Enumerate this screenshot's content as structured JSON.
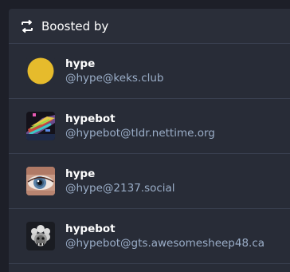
{
  "header": {
    "title": "Boosted by",
    "icon": "boost-icon"
  },
  "accounts": [
    {
      "display_name": "hype",
      "handle": "@hype@keks.club",
      "avatar": "yellow-circle-avatar"
    },
    {
      "display_name": "hypebot",
      "handle": "@hypebot@tldr.nettime.org",
      "avatar": "glitch-art-avatar"
    },
    {
      "display_name": "hype",
      "handle": "@hype@2137.social",
      "avatar": "eye-closeup-avatar"
    },
    {
      "display_name": "hypebot",
      "handle": "@hypebot@gts.awesomesheep48.ca",
      "avatar": "sheep-avatar"
    }
  ],
  "colors": {
    "background": "#1d1f28",
    "panel": "#282c37",
    "handle_text": "#9baec8",
    "name_text": "#ffffff"
  }
}
